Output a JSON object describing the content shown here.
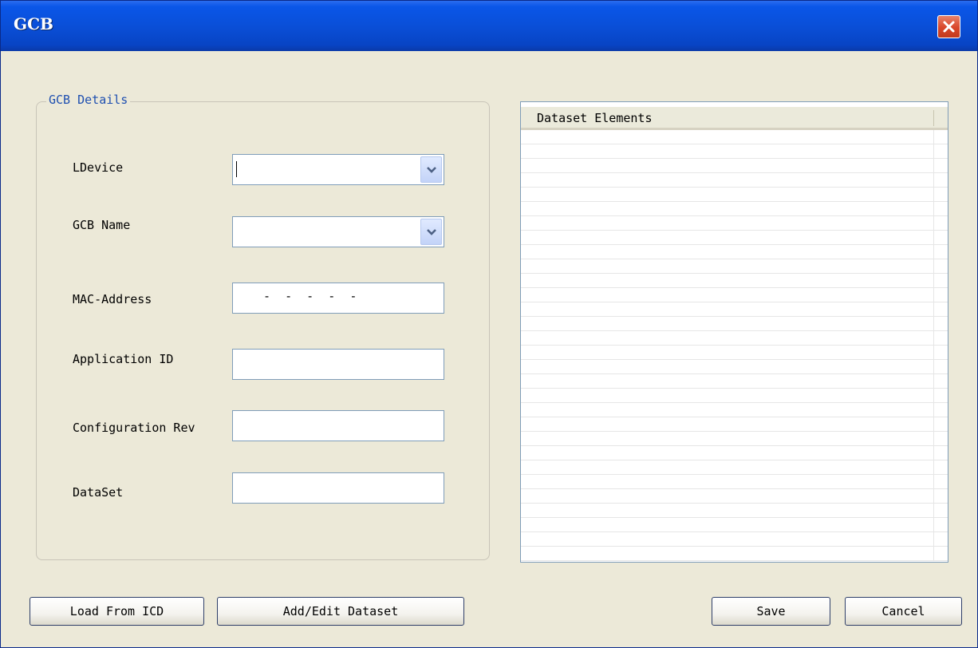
{
  "window": {
    "title": "GCB",
    "close_icon": "close-icon",
    "titlebar_color": "#0a4fd8"
  },
  "group": {
    "label": "GCB Details"
  },
  "fields": {
    "ldevice": {
      "label": "LDevice",
      "value": ""
    },
    "gcb_name": {
      "label": "GCB Name",
      "value": ""
    },
    "mac_address": {
      "label": "MAC-Address",
      "value": "-  -  -  -  -"
    },
    "application_id": {
      "label": "Application ID",
      "value": ""
    },
    "configuration_rev": {
      "label": "Configuration Rev",
      "value": ""
    },
    "dataset": {
      "label": "DataSet",
      "value": ""
    }
  },
  "dataset_list": {
    "column_header": "Dataset Elements",
    "items": []
  },
  "buttons": {
    "load_from_icd": "Load From ICD",
    "add_edit_dataset": "Add/Edit Dataset",
    "save": "Save",
    "cancel": "Cancel"
  }
}
